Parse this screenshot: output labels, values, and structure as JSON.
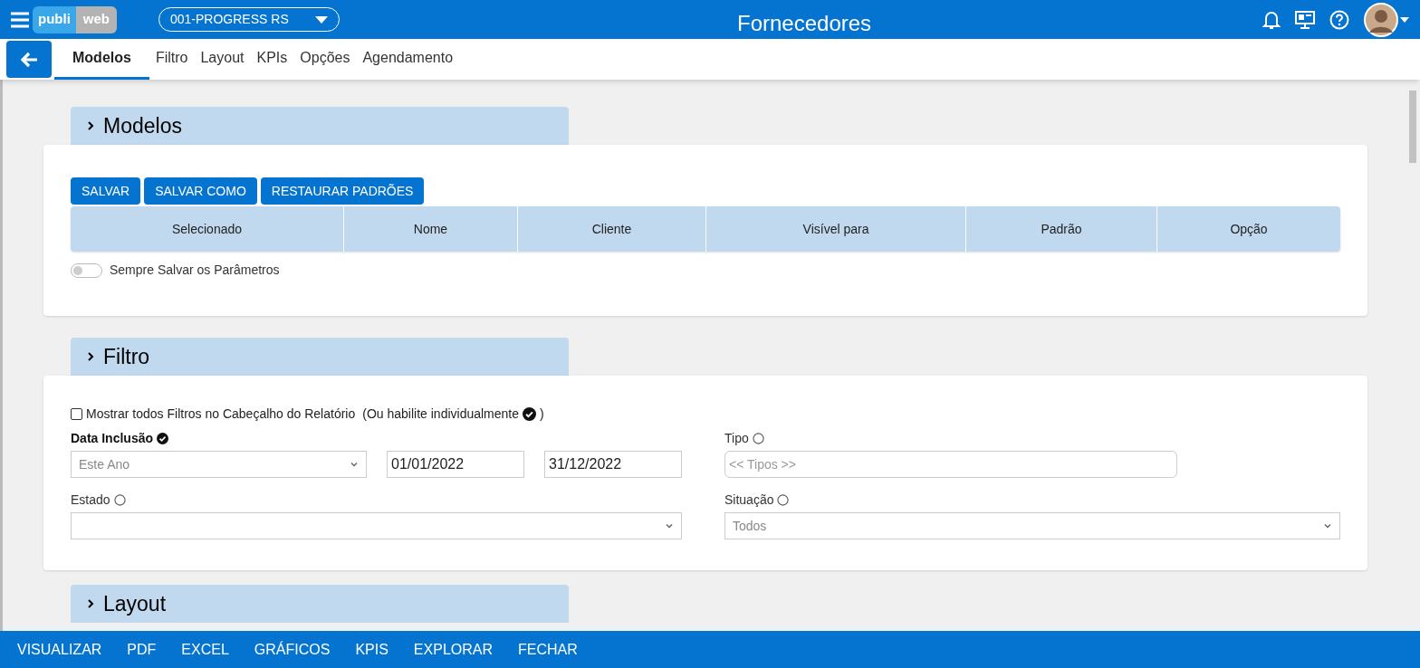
{
  "header": {
    "logo": [
      "publi",
      "web"
    ],
    "company": "001-PROGRESS RS",
    "title": "Fornecedores"
  },
  "tabs": [
    {
      "label": "Modelos",
      "selected": true
    },
    {
      "label": "Filtro",
      "selected": false
    },
    {
      "label": "Layout",
      "selected": false
    },
    {
      "label": "KPIs",
      "selected": false
    },
    {
      "label": "Opções",
      "selected": false
    },
    {
      "label": "Agendamento",
      "selected": false
    }
  ],
  "modelos": {
    "title": "Modelos",
    "buttons": [
      "SALVAR",
      "SALVAR COMO",
      "RESTAURAR PADRÕES"
    ],
    "columns": [
      "Selecionado",
      "Nome",
      "Cliente",
      "Visível para",
      "Padrão",
      "Opção"
    ],
    "toggle": {
      "label": "Sempre Salvar os Parâmetros",
      "on": false
    }
  },
  "filtro": {
    "title": "Filtro",
    "show_all": {
      "label": "Mostrar todos Filtros no Cabeçalho do Relatório",
      "hint_open": "(Ou habilite individualmente",
      "hint_close": ")",
      "checked": false
    },
    "data_inclusao": {
      "label": "Data Inclusão",
      "in_header": true,
      "period": "Este Ano",
      "from": "01/01/2022",
      "to": "31/12/2022"
    },
    "tipo": {
      "label": "Tipo",
      "in_header": false,
      "placeholder": "<< Tipos >>"
    },
    "estado": {
      "label": "Estado",
      "in_header": false
    },
    "situacao": {
      "label": "Situação",
      "in_header": false,
      "value": "Todos"
    }
  },
  "layout": {
    "title": "Layout"
  },
  "bottom_bar": [
    "VISUALIZAR",
    "PDF",
    "EXCEL",
    "GRÁFICOS",
    "KPIS",
    "EXPLORAR",
    "FECHAR"
  ]
}
